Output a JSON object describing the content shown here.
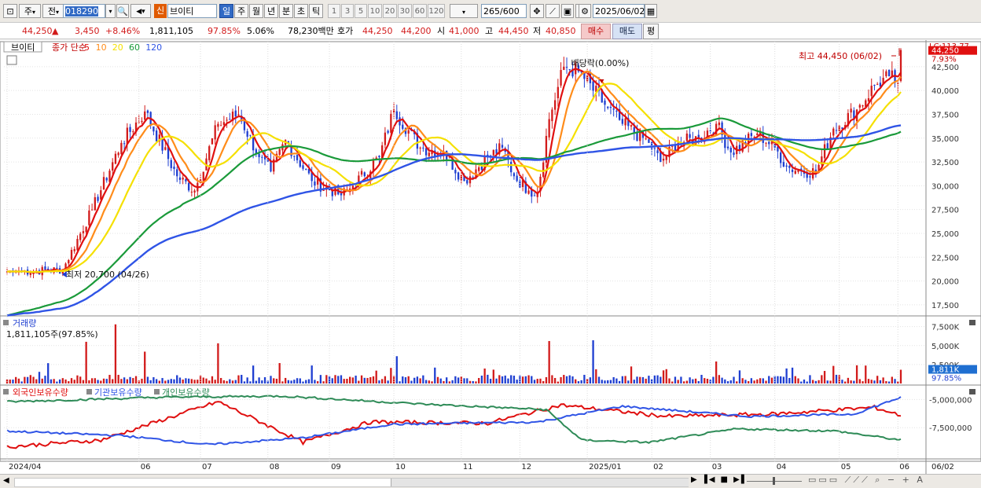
{
  "toolbar": {
    "market": "주",
    "prev_btn": "전",
    "code": "018290",
    "stock_badge": "신",
    "stock_name": "브이티",
    "periods": [
      "일",
      "주",
      "월",
      "년",
      "분",
      "초",
      "틱"
    ],
    "period_selected": "일",
    "minute_opts": [
      "1",
      "3",
      "5",
      "10",
      "20",
      "30",
      "60",
      "120"
    ],
    "count": "265",
    "count_total": "/600",
    "date": "2025/06/02"
  },
  "quote": {
    "price": "44,250",
    "arrow": "▲",
    "change": "3,450",
    "change_pct": "+8.46%",
    "volume": "1,811,105",
    "vol_ratio": "97.85%",
    "turnover": "5.06%",
    "amount": "78,230백만",
    "bid_label": "호가",
    "ask": "44,250",
    "bid": "44,200",
    "open_label": "시",
    "open": "41,000",
    "high_label": "고",
    "high": "44,450",
    "low_label": "저",
    "low": "40,850",
    "buy_btn": "매수",
    "sell_btn": "매도",
    "eval_btn": "평"
  },
  "legend": {
    "name": "브이티",
    "ma_label": "종가 단순",
    "ma5": "5",
    "ma10": "10",
    "ma20": "20",
    "ma60": "60",
    "ma120": "120"
  },
  "colors": {
    "up": "#d21b1b",
    "down": "#1f3fd1",
    "ma5": "#e01010",
    "ma10": "#ff8c1a",
    "ma20": "#f5e000",
    "ma60": "#1a9a3a",
    "ma120": "#2f54e6",
    "foreign": "#e01010",
    "inst": "#2f54e6",
    "indiv": "#2e8b57"
  },
  "annotations": {
    "high": "최고 44,450 (06/02)",
    "low": "최저 20,700 (04/26)",
    "dividend": "배당락(0.00%)",
    "lc": "LC:113.77",
    "last_price": "44,250",
    "last_pct": "7.93%",
    "vol_title": "거래량",
    "vol_value": "1,811,105주(97.85%)",
    "vol_last": "1,811K",
    "vol_pct": "97.85%",
    "flow_foreign": "외국인보유수량",
    "flow_inst": "기관보유수량",
    "flow_indiv": "개인보유수량",
    "last_date": "06/02"
  },
  "chart_data": [
    {
      "type": "candlestick",
      "title": "브이티",
      "y_ticks": [
        "42,500",
        "40,000",
        "37,500",
        "35,000",
        "32,500",
        "30,000",
        "27,500",
        "25,000",
        "22,500",
        "20,000",
        "17,500"
      ],
      "ylim": [
        16500,
        44800
      ],
      "x_ticks": [
        "2024/04",
        "06",
        "07",
        "08",
        "09",
        "10",
        "11",
        "12",
        "2025/01",
        "02",
        "03",
        "04",
        "05",
        "06"
      ],
      "anchor_closes": [
        [
          "2024/04/05",
          21000
        ],
        [
          "2024/04/26",
          21200
        ],
        [
          "2024/05/10",
          27500
        ],
        [
          "2024/05/24",
          34500
        ],
        [
          "2024/06/05",
          37800
        ],
        [
          "2024/06/20",
          31000
        ],
        [
          "2024/06/28",
          29500
        ],
        [
          "2024/07/10",
          36500
        ],
        [
          "2024/07/20",
          37500
        ],
        [
          "2024/07/30",
          33000
        ],
        [
          "2024/08/05",
          31500
        ],
        [
          "2024/08/12",
          34800
        ],
        [
          "2024/08/25",
          30500
        ],
        [
          "2024/09/06",
          29000
        ],
        [
          "2024/09/12",
          30000
        ],
        [
          "2024/09/25",
          33000
        ],
        [
          "2024/10/02",
          38000
        ],
        [
          "2024/10/15",
          34000
        ],
        [
          "2024/10/25",
          33500
        ],
        [
          "2024/11/05",
          30500
        ],
        [
          "2024/11/15",
          33000
        ],
        [
          "2024/11/22",
          34000
        ],
        [
          "2024/11/28",
          31000
        ],
        [
          "2024/12/05",
          29500
        ],
        [
          "2024/12/10",
          29300
        ],
        [
          "2024/12/16",
          37000
        ],
        [
          "2024/12/23",
          42500
        ],
        [
          "2024/12/30",
          42000
        ],
        [
          "2025/01/10",
          38500
        ],
        [
          "2025/01/20",
          36500
        ],
        [
          "2025/01/31",
          34500
        ],
        [
          "2025/02/06",
          32500
        ],
        [
          "2025/02/15",
          34500
        ],
        [
          "2025/02/25",
          35000
        ],
        [
          "2025/03/05",
          36500
        ],
        [
          "2025/03/12",
          33500
        ],
        [
          "2025/03/25",
          35500
        ],
        [
          "2025/04/02",
          34000
        ],
        [
          "2025/04/08",
          32000
        ],
        [
          "2025/04/15",
          31500
        ],
        [
          "2025/04/22",
          31500
        ],
        [
          "2025/04/30",
          36000
        ],
        [
          "2025/05/12",
          38000
        ],
        [
          "2025/05/20",
          40500
        ],
        [
          "2025/05/27",
          41500
        ],
        [
          "2025/05/30",
          40800
        ],
        [
          "2025/06/02",
          44250
        ]
      ],
      "last": {
        "open": 41000,
        "high": 44450,
        "low": 40850,
        "close": 44250
      },
      "period_high": {
        "value": 44450,
        "date": "06/02"
      },
      "period_low": {
        "value": 20700,
        "date": "04/26"
      }
    },
    {
      "type": "bar",
      "title": "거래량",
      "y_ticks": [
        "7,500K",
        "5,000K",
        "2,500K"
      ],
      "ylim": [
        0,
        8500000
      ],
      "peaks": [
        [
          "2024/05/08",
          5500000
        ],
        [
          "2024/05/22",
          7800000
        ],
        [
          "2024/06/05",
          4200000
        ],
        [
          "2024/07/10",
          5300000
        ],
        [
          "2024/10/03",
          3600000
        ],
        [
          "2024/12/16",
          5600000
        ],
        [
          "2025/01/06",
          5700000
        ],
        [
          "2025/03/05",
          2900000
        ],
        [
          "2025/05/12",
          2400000
        ],
        [
          "2025/06/02",
          1811105
        ]
      ]
    },
    {
      "type": "line",
      "title": "보유수량",
      "y_ticks": [
        "-5,000,000",
        "-7,500,000"
      ],
      "ylim": [
        -10200000,
        -4000000
      ],
      "series": [
        {
          "name": "외국인보유수량",
          "anchors": [
            [
              "2024/04/01",
              -9200000
            ],
            [
              "2024/05/15",
              -8600000
            ],
            [
              "2024/07/10",
              -5200000
            ],
            [
              "2024/08/20",
              -8800000
            ],
            [
              "2024/09/20",
              -7000000
            ],
            [
              "2024/11/15",
              -7100000
            ],
            [
              "2024/12/20",
              -5500000
            ],
            [
              "2025/02/10",
              -6500000
            ],
            [
              "2025/04/01",
              -6300000
            ],
            [
              "2025/05/20",
              -5700000
            ],
            [
              "2025/06/02",
              -6400000
            ]
          ]
        },
        {
          "name": "기관보유수량",
          "anchors": [
            [
              "2024/04/01",
              -7800000
            ],
            [
              "2024/05/25",
              -8200000
            ],
            [
              "2024/07/05",
              -9000000
            ],
            [
              "2024/08/20",
              -8400000
            ],
            [
              "2024/10/01",
              -7200000
            ],
            [
              "2024/12/10",
              -7000000
            ],
            [
              "2025/01/20",
              -5600000
            ],
            [
              "2025/03/20",
              -6500000
            ],
            [
              "2025/05/10",
              -6300000
            ],
            [
              "2025/06/02",
              -4800000
            ]
          ]
        },
        {
          "name": "개인보유수량",
          "anchors": [
            [
              "2024/04/01",
              -5200000
            ],
            [
              "2024/06/15",
              -4800000
            ],
            [
              "2024/08/10",
              -4700000
            ],
            [
              "2024/10/15",
              -5400000
            ],
            [
              "2024/12/15",
              -5900000
            ],
            [
              "2024/12/31",
              -8600000
            ],
            [
              "2025/01/31",
              -8800000
            ],
            [
              "2025/03/15",
              -7600000
            ],
            [
              "2025/05/01",
              -7800000
            ],
            [
              "2025/06/02",
              -8600000
            ]
          ]
        }
      ]
    }
  ]
}
